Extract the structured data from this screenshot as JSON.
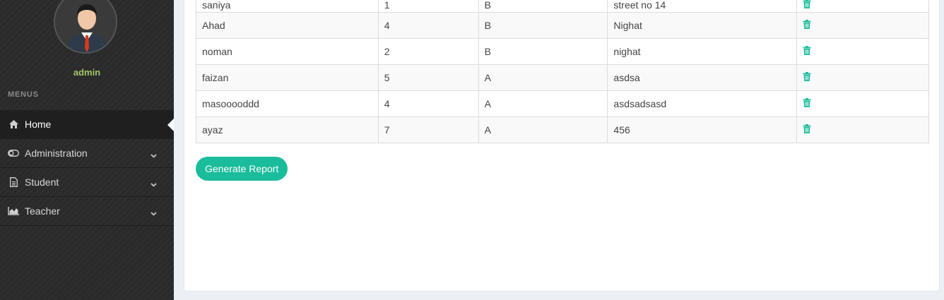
{
  "sidebar": {
    "user_name": "admin",
    "menus_label": "MENUS",
    "items": [
      {
        "label": "Home",
        "icon": "home-icon",
        "active": true
      },
      {
        "label": "Administration",
        "icon": "toggle-icon",
        "expandable": true
      },
      {
        "label": "Student",
        "icon": "file-text-icon",
        "expandable": true
      },
      {
        "label": "Teacher",
        "icon": "area-chart-icon",
        "expandable": true
      }
    ]
  },
  "table": {
    "rows": [
      {
        "name": "saniya",
        "c2": "1",
        "c3": "B",
        "c4": "street no 14"
      },
      {
        "name": "Ahad",
        "c2": "4",
        "c3": "B",
        "c4": "Nighat"
      },
      {
        "name": "noman",
        "c2": "2",
        "c3": "B",
        "c4": "nighat"
      },
      {
        "name": "faizan",
        "c2": "5",
        "c3": "A",
        "c4": "asdsa"
      },
      {
        "name": "masooooddd",
        "c2": "4",
        "c3": "A",
        "c4": "asdsadsasd"
      },
      {
        "name": "ayaz",
        "c2": "7",
        "c3": "A",
        "c4": "456"
      }
    ]
  },
  "actions": {
    "generate_report": "Generate Report"
  },
  "colors": {
    "accent": "#1abc9c",
    "sidebar_bg": "#2a2a2a",
    "username": "#a3c569"
  }
}
